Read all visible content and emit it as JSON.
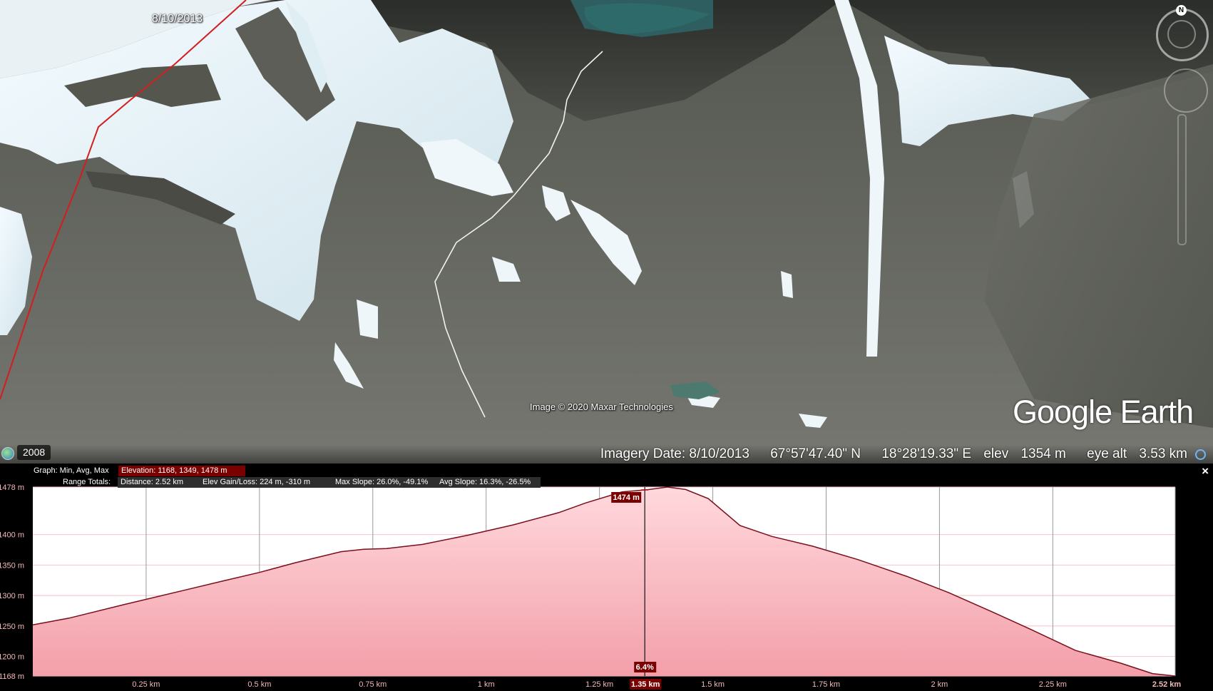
{
  "viewport": {
    "overlay_date": "8/10/2013",
    "attribution": "Image © 2020 Maxar Technologies",
    "logo": "Google Earth",
    "historical_imagery_icon": "clock-globe-icon",
    "historical_year": "2008",
    "nav": {
      "north_label": "N"
    },
    "status": {
      "imagery_date": "Imagery Date: 8/10/2013",
      "latitude": "67°57'47.40\" N",
      "longitude": "18°28'19.33\" E",
      "elev_label": "elev",
      "elev_value": "1354 m",
      "eye_alt_label": "eye alt",
      "eye_alt_value": "3.53 km"
    }
  },
  "profile_panel": {
    "close_label": "×",
    "graph_label": "Graph: Min, Avg, Max",
    "elevation_summary": "Elevation: 1168, 1349, 1478 m",
    "range_totals_label": "Range Totals:",
    "distance": "Distance: 2.52 km",
    "elev_gain_loss": "Elev Gain/Loss: 224 m, -310 m",
    "max_slope": "Max Slope: 26.0%, -49.1%",
    "avg_slope": "Avg Slope: 16.3%, -26.5%",
    "cursor": {
      "distance_km": 1.35,
      "distance_label": "1.35 km",
      "elevation_label": "1474 m",
      "slope_label": "6.4%"
    }
  },
  "chart_data": {
    "type": "area",
    "xlabel": "",
    "ylabel": "",
    "x_unit": "km",
    "y_unit": "m",
    "xlim": [
      0,
      2.52
    ],
    "ylim": [
      1168,
      1478
    ],
    "y_ticks": [
      {
        "value": 1478,
        "label": "1478 m"
      },
      {
        "value": 1400,
        "label": "1400 m"
      },
      {
        "value": 1350,
        "label": "1350 m"
      },
      {
        "value": 1300,
        "label": "1300 m"
      },
      {
        "value": 1250,
        "label": "1250 m"
      },
      {
        "value": 1200,
        "label": "1200 m"
      },
      {
        "value": 1168,
        "label": "1168 m"
      }
    ],
    "x_ticks": [
      {
        "value": 0.25,
        "label": "0.25 km"
      },
      {
        "value": 0.5,
        "label": "0.5 km"
      },
      {
        "value": 0.75,
        "label": "0.75 km"
      },
      {
        "value": 1.0,
        "label": "1 km"
      },
      {
        "value": 1.25,
        "label": "1.25 km"
      },
      {
        "value": 1.5,
        "label": "1.5 km"
      },
      {
        "value": 1.75,
        "label": "1.75 km"
      },
      {
        "value": 2.0,
        "label": "2 km"
      },
      {
        "value": 2.25,
        "label": "2.25 km"
      },
      {
        "value": 2.52,
        "label": "2.52 km"
      }
    ],
    "series": [
      {
        "x": [
          0,
          0.08,
          0.2,
          0.33,
          0.42,
          0.5,
          0.58,
          0.68,
          0.73,
          0.78,
          0.86,
          0.96,
          1.06,
          1.16,
          1.22,
          1.3,
          1.36,
          1.4,
          1.44,
          1.49,
          1.56,
          1.63,
          1.72,
          1.82,
          1.93,
          2.02,
          2.12,
          2.2,
          2.3,
          2.4,
          2.47,
          2.52
        ],
        "y": [
          1252,
          1263,
          1285,
          1308,
          1324,
          1338,
          1354,
          1372,
          1376,
          1377,
          1384,
          1399,
          1416,
          1436,
          1452,
          1470,
          1474,
          1478,
          1474,
          1459,
          1415,
          1397,
          1381,
          1359,
          1331,
          1305,
          1272,
          1245,
          1210,
          1189,
          1172,
          1168
        ]
      }
    ],
    "grid": true,
    "colors": {
      "line": "#7a0e1a",
      "fill_top": "#ffd9dd",
      "fill_bottom": "#f39fa9",
      "cursor": "#222222"
    }
  }
}
